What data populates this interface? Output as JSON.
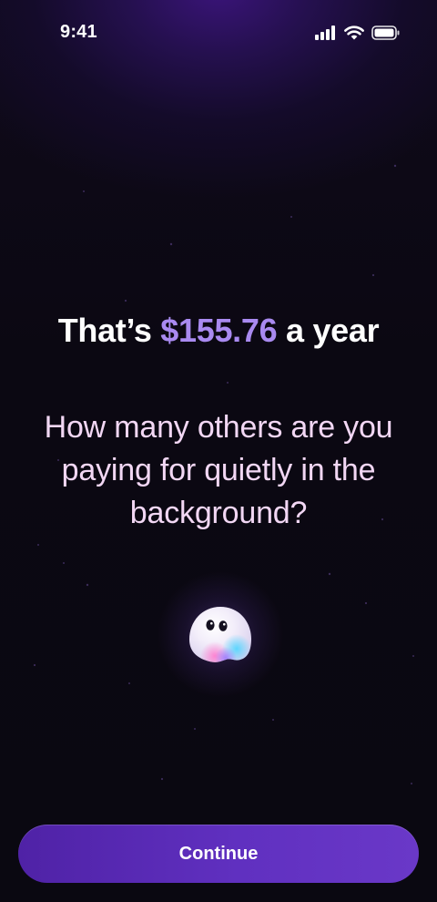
{
  "status_bar": {
    "time": "9:41",
    "icons": [
      "cellular-signal-icon",
      "wifi-icon",
      "battery-icon"
    ]
  },
  "headline": {
    "prefix": "That’s ",
    "amount": "$155.76",
    "suffix": " a year"
  },
  "question": "How many others are you paying for quietly in the background?",
  "mascot": "ghost-icon",
  "continue_label": "Continue",
  "colors": {
    "background": "#0b0812",
    "accent_amount": "#a98af0",
    "question_text": "#f2d7f4",
    "button": "#5a2bb8"
  }
}
